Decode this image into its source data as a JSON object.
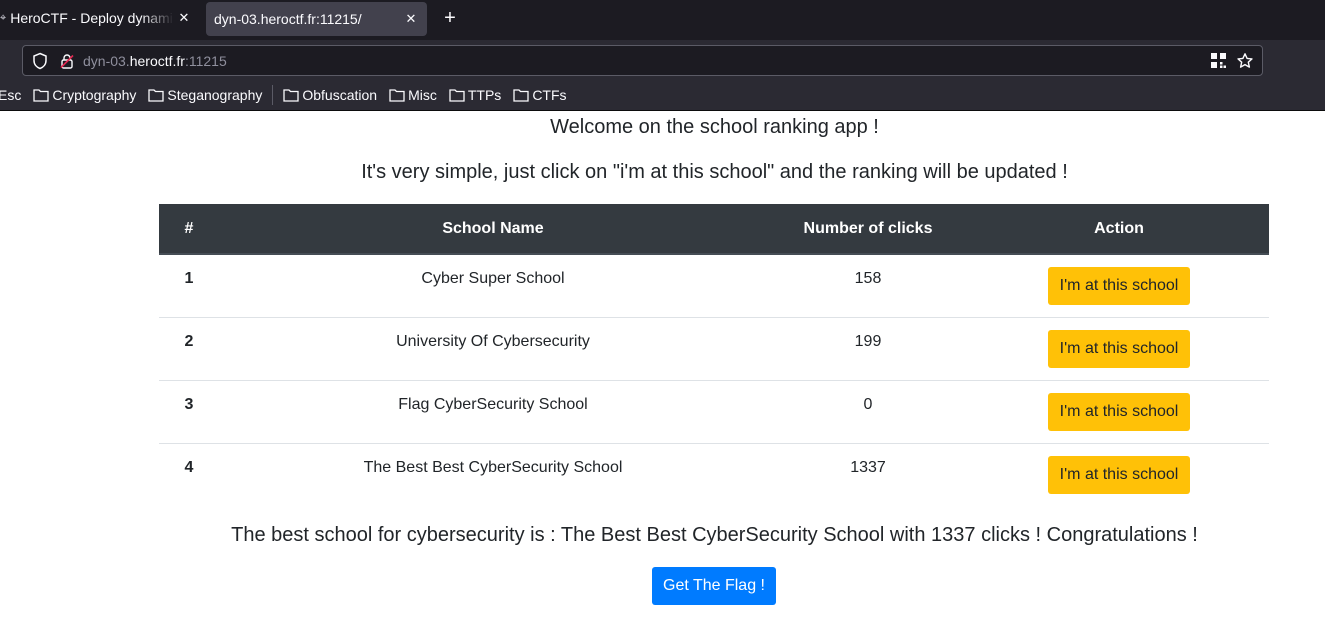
{
  "browser": {
    "tabs": [
      {
        "title": "HeroCTF - Deploy dynami",
        "active": false
      },
      {
        "title": "dyn-03.heroctf.fr:11215/",
        "active": true
      }
    ],
    "url": {
      "prefix": "dyn-03.",
      "host": "heroctf.fr",
      "suffix": ":11215"
    },
    "bookmarks": [
      "Esc",
      "Cryptography",
      "Steganography",
      "Obfuscation",
      "Misc",
      "TTPs",
      "CTFs"
    ]
  },
  "page": {
    "welcome": "Welcome on the school ranking app !",
    "intro": "It's very simple, just click on \"i'm at this school\" and the ranking will be updated !",
    "table": {
      "headers": [
        "#",
        "School Name",
        "Number of clicks",
        "Action"
      ],
      "rows": [
        {
          "rank": "1",
          "name": "Cyber Super School",
          "clicks": "158",
          "action": "I'm at this school"
        },
        {
          "rank": "2",
          "name": "University Of Cybersecurity",
          "clicks": "199",
          "action": "I'm at this school"
        },
        {
          "rank": "3",
          "name": "Flag CyberSecurity School",
          "clicks": "0",
          "action": "I'm at this school"
        },
        {
          "rank": "4",
          "name": "The Best Best CyberSecurity School",
          "clicks": "1337",
          "action": "I'm at this school"
        }
      ]
    },
    "result": "The best school for cybersecurity is : The Best Best CyberSecurity School with 1337 clicks ! Congratulations !",
    "flag_button": "Get The Flag !"
  },
  "colors": {
    "table_header": "#343a40",
    "school_button": "#ffc107",
    "flag_button": "#007bff"
  },
  "icons": [
    "close-icon",
    "new-tab-icon",
    "shield-icon",
    "lock-icon",
    "qr-code-icon",
    "bookmark-star-icon",
    "folder-icon"
  ]
}
